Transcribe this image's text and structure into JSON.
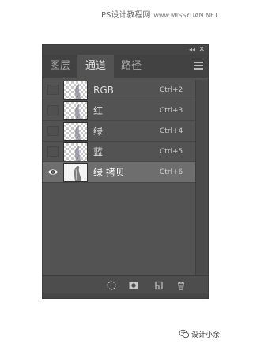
{
  "site": {
    "title": "PS设计教程网",
    "url": "www.MISSYUAN.NET"
  },
  "panel": {
    "tabs": [
      {
        "label": "图层",
        "active": false
      },
      {
        "label": "通道",
        "active": true
      },
      {
        "label": "路径",
        "active": false
      }
    ],
    "topbar": {
      "collapse_glyph": "◂◂",
      "close_glyph": "✕"
    },
    "channels": [
      {
        "name": "RGB",
        "shortcut": "Ctrl+2",
        "visible": false,
        "selected": false
      },
      {
        "name": "红",
        "shortcut": "Ctrl+3",
        "visible": false,
        "selected": false
      },
      {
        "name": "绿",
        "shortcut": "Ctrl+4",
        "visible": false,
        "selected": false
      },
      {
        "name": "蓝",
        "shortcut": "Ctrl+5",
        "visible": false,
        "selected": false
      },
      {
        "name": "绿 拷贝",
        "shortcut": "Ctrl+6",
        "visible": true,
        "selected": true
      }
    ],
    "footer_icons": [
      "load-selection-icon",
      "save-selection-icon",
      "new-channel-icon",
      "delete-channel-icon"
    ],
    "colors": {
      "panel_bg": "#535353",
      "selected_row": "#6e6e6e",
      "tab_bar": "#424242"
    }
  },
  "watermark": {
    "text": "设计小余"
  }
}
